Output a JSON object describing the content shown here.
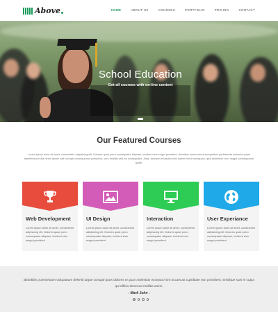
{
  "header": {
    "logo_text": "Above",
    "nav": [
      {
        "label": "HOME",
        "active": true
      },
      {
        "label": "ABOUT US",
        "active": false
      },
      {
        "label": "COURSES",
        "active": false
      },
      {
        "label": "PORTFOLIO",
        "active": false
      },
      {
        "label": "PRICING",
        "active": false
      },
      {
        "label": "CONTACT",
        "active": false
      }
    ]
  },
  "hero": {
    "title": "School Education",
    "subtitle": "Get all courses with on-line content"
  },
  "featured": {
    "title": "Our Featured Courses",
    "description": "Lorem ipsum dolor sit amet, consectetur adipisicing elit. Dolores quae porro consequatur aliquam, incidunt eius magni provident, doloribus omnis minus temporibus perferendis nesciunt quam repellendus nulla nemo ipsum odit corrupti consequuntur possimus, vero mollitia velit ad consequatur. Alias, laborum excepturi nihil autem nemo numquam, ipsa architecto non, magni consequuntur quam."
  },
  "cards": [
    {
      "title": "Web Development",
      "text": "Lorem ipsum dolor sit amet, consectetur adipisicing elit. Dolores quae porro consequatur aliquam, incidunt eius magni provident",
      "color": "#e74c3c",
      "icon": "trophy-icon"
    },
    {
      "title": "UI Design",
      "text": "Lorem ipsum dolor sit amet, consectetur adipisicing elit. Dolores quae porro consequatur aliquam, incidunt eius magni provident",
      "color": "#d35cb8",
      "icon": "image-icon"
    },
    {
      "title": "Interaction",
      "text": "Lorem ipsum dolor sit amet, consectetur adipisicing elit. Dolores quae porro consequatur aliquam, incidunt eius magni provident",
      "color": "#2ecc55",
      "icon": "monitor-icon"
    },
    {
      "title": "User Experiance",
      "text": "Lorem ipsum dolor sit amet, consectetur adipisicing elit. Dolores quae porro consequatur aliquam, incidunt eius magni provident",
      "color": "#1fa9e8",
      "icon": "globe-icon"
    }
  ],
  "testimonial": {
    "quote": "Blanditiis praesentium voluptatum deleniti atque corrupti quos dolores et quas molestias excepturi sint occaecati cupiditate non provident, similique sunt in culpa qui officia deserunt mollitia animi.",
    "author": "- Mark John -"
  },
  "colors": {
    "brand": "#1a9c5a"
  }
}
